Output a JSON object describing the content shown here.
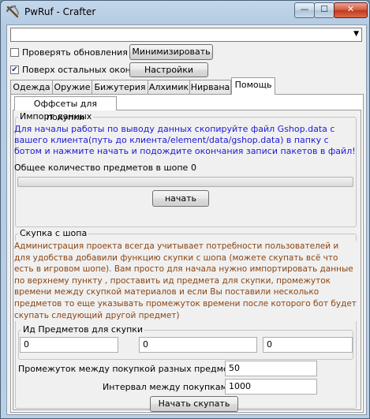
{
  "window": {
    "title": "PwRuf - Crafter"
  },
  "caption": {
    "minimize": "—",
    "maximize": "☐",
    "close": "✕"
  },
  "toolbar": {
    "combo_value": "",
    "check_updates": {
      "label": "Проверять обновления",
      "checked": false
    },
    "always_on_top": {
      "label": "Поверх остальных окон",
      "checked": true
    },
    "minimize_button": "Минимизировать",
    "settings_button": "Настройки"
  },
  "tabs": [
    {
      "label": "Одежда",
      "active": false
    },
    {
      "label": "Оружие",
      "active": false
    },
    {
      "label": "Бижутерия",
      "active": false
    },
    {
      "label": "Алхимик",
      "active": false
    },
    {
      "label": "Нирвана",
      "active": false
    },
    {
      "label": "Помощь",
      "active": true
    }
  ],
  "subtab": {
    "label": "Оффсеты для покупки"
  },
  "import_group": {
    "title": "Импорт данных",
    "instructions": "Для началы работы по выводу данных скопируйте файл Gshop.data с вашего клиента(путь до клиента/element/data/gshop.data) в папку с ботом и нажмите начать и подождите окончания записи пакетов в файл!",
    "total_label": "Общее количество предметов в шопе",
    "total_value": "0",
    "progress": 0,
    "start_button": "начать"
  },
  "buy_group": {
    "title": "Скупка с шопа",
    "description": "Администрация проекта всегда учитывает потребности пользователей и для удобства добавили функцию скупки с шопа (можете скупать всё что есть в игровом шопе). Вам просто для начала нужно импортировать данные по верхнему пункту , проставить ид предмета для скупки, промежуток времени между скупкой материалов и если Вы поставили несколько предметов то еще указывать промежуток времени после которого бот будет скупать следующий другой предмет)",
    "ids_title": "Ид Предметов для скупки",
    "ids": [
      "0",
      "0",
      "0"
    ],
    "interval_items_label": "Промежуток между покупкой разных предметов",
    "interval_items_value": "50",
    "interval_buys_label": "Интервал между покупками",
    "interval_buys_value": "1000",
    "start_button": "Начать скупать"
  }
}
